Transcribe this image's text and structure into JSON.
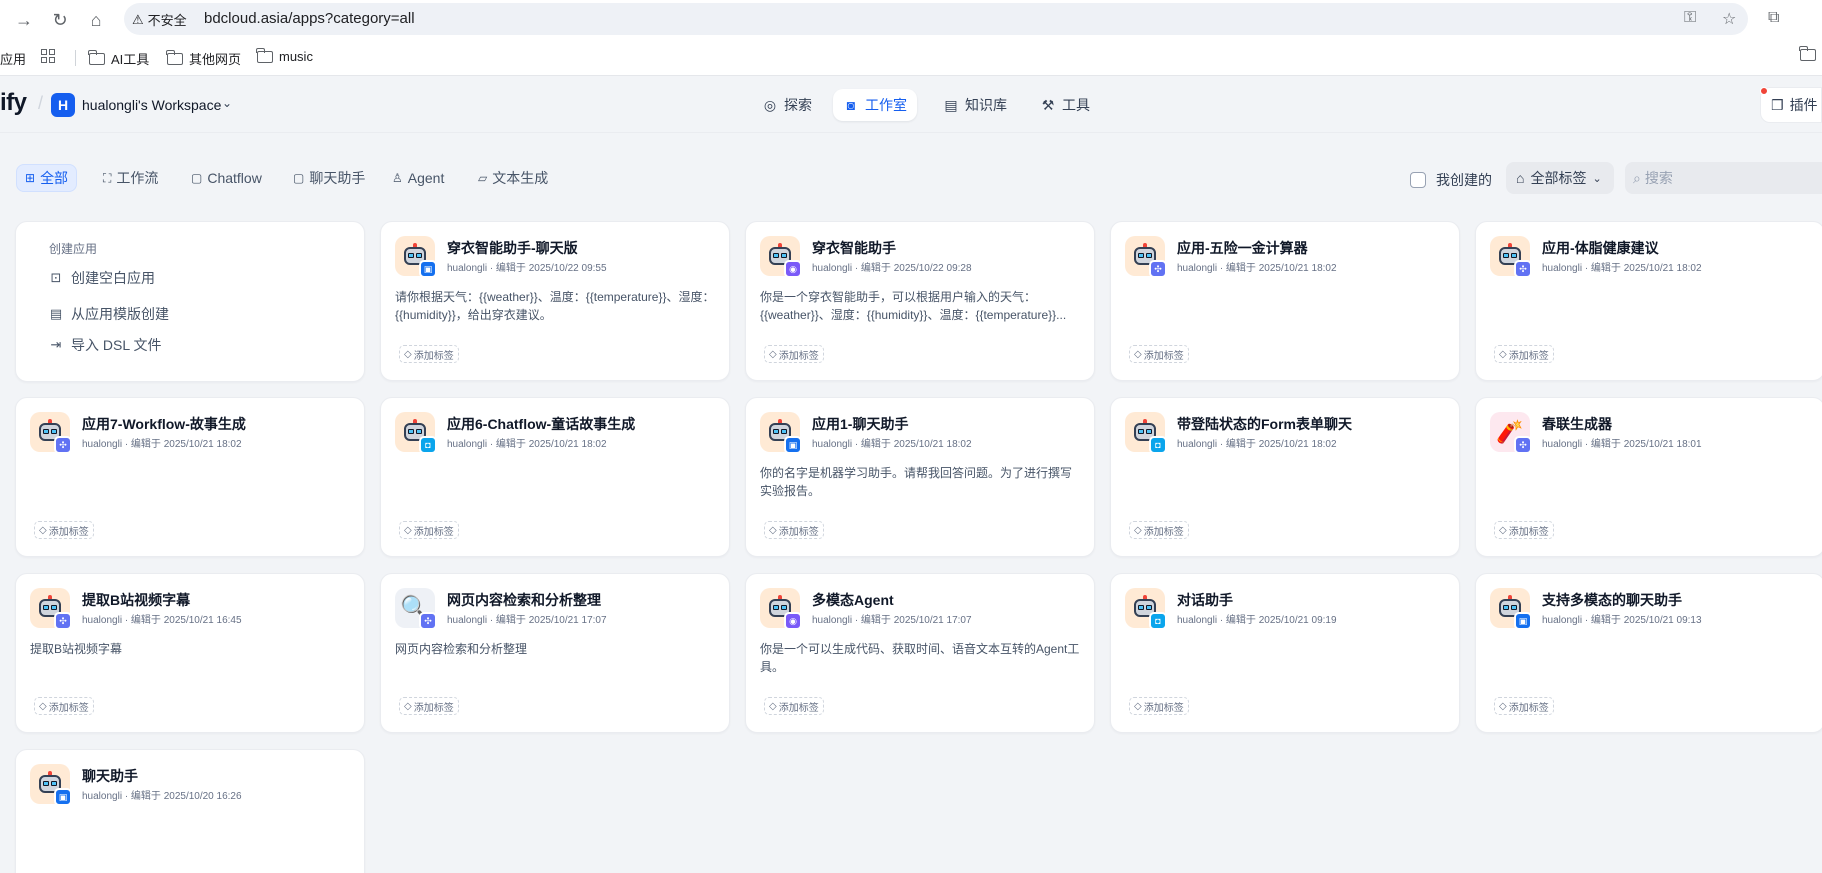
{
  "browser": {
    "url_warning": "不安全",
    "url": "bdcloud.asia/apps?category=all",
    "bookmarks": [
      "应用",
      "AI工具",
      "其他网页",
      "music"
    ]
  },
  "header": {
    "logo": "ify",
    "workspace_initial": "H",
    "workspace_name": "hualongli's Workspace",
    "nav": [
      "探索",
      "工作室",
      "知识库",
      "工具"
    ],
    "plugin_label": "插件"
  },
  "filters": {
    "tabs": [
      "全部",
      "工作流",
      "Chatflow",
      "聊天助手",
      "Agent",
      "文本生成"
    ],
    "mine_label": "我创建的",
    "tags_label": "全部标签",
    "search_placeholder": "搜索"
  },
  "create_card": {
    "title": "创建应用",
    "items": [
      "创建空白应用",
      "从应用模版创建",
      "导入 DSL 文件"
    ]
  },
  "tag_button_label": "添加标签",
  "apps": [
    {
      "name": "穿衣智能助手-聊天版",
      "meta": "hualongli · 编辑于 2025/10/22 09:55",
      "desc": "请你根据天气：{{weather}}、温度：{{temperature}}、湿度：{{humidity}}，给出穿衣建议。",
      "badge": "chat"
    },
    {
      "name": "穿衣智能助手",
      "meta": "hualongli · 编辑于 2025/10/22 09:28",
      "desc": "你是一个穿衣智能助手，可以根据用户输入的天气：{{weather}}、湿度：{{humidity}}、温度：{{temperature}}...",
      "badge": "agent"
    },
    {
      "name": "应用-五险一金计算器",
      "meta": "hualongli · 编辑于 2025/10/21 18:02",
      "desc": "",
      "badge": "flow"
    },
    {
      "name": "应用-体脂健康建议",
      "meta": "hualongli · 编辑于 2025/10/21 18:02",
      "desc": "",
      "badge": "flow"
    },
    {
      "name": "应用7-Workflow-故事生成",
      "meta": "hualongli · 编辑于 2025/10/21 18:02",
      "desc": "",
      "badge": "flow"
    },
    {
      "name": "应用6-Chatflow-童话故事生成",
      "meta": "hualongli · 编辑于 2025/10/21 18:02",
      "desc": "",
      "badge": "cf"
    },
    {
      "name": "应用1-聊天助手",
      "meta": "hualongli · 编辑于 2025/10/21 18:02",
      "desc": "你的名字是机器学习助手。请帮我回答问题。为了进行撰写实验报告。",
      "badge": "chat"
    },
    {
      "name": "带登陆状态的Form表单聊天",
      "meta": "hualongli · 编辑于 2025/10/21 18:02",
      "desc": "",
      "badge": "cf"
    },
    {
      "name": "春联生成器",
      "meta": "hualongli · 编辑于 2025/10/21 18:01",
      "desc": "",
      "badge": "flow"
    },
    {
      "name": "提取B站视频字幕",
      "meta": "hualongli · 编辑于 2025/10/21 16:45",
      "desc": "提取B站视频字幕",
      "badge": "flow"
    },
    {
      "name": "网页内容检索和分析整理",
      "meta": "hualongli · 编辑于 2025/10/21 17:07",
      "desc": "网页内容检索和分析整理",
      "badge": "flow"
    },
    {
      "name": "多模态Agent",
      "meta": "hualongli · 编辑于 2025/10/21 17:07",
      "desc": "你是一个可以生成代码、获取时间、语音文本互转的Agent工具。",
      "badge": "agent"
    },
    {
      "name": "对话助手",
      "meta": "hualongli · 编辑于 2025/10/21 09:19",
      "desc": "",
      "badge": "cf"
    },
    {
      "name": "支持多模态的聊天助手",
      "meta": "hualongli · 编辑于 2025/10/21 09:13",
      "desc": "",
      "badge": "chat"
    },
    {
      "name": "聊天助手",
      "meta": "hualongli · 编辑于 2025/10/20 16:26",
      "desc": "",
      "badge": "chat"
    }
  ]
}
